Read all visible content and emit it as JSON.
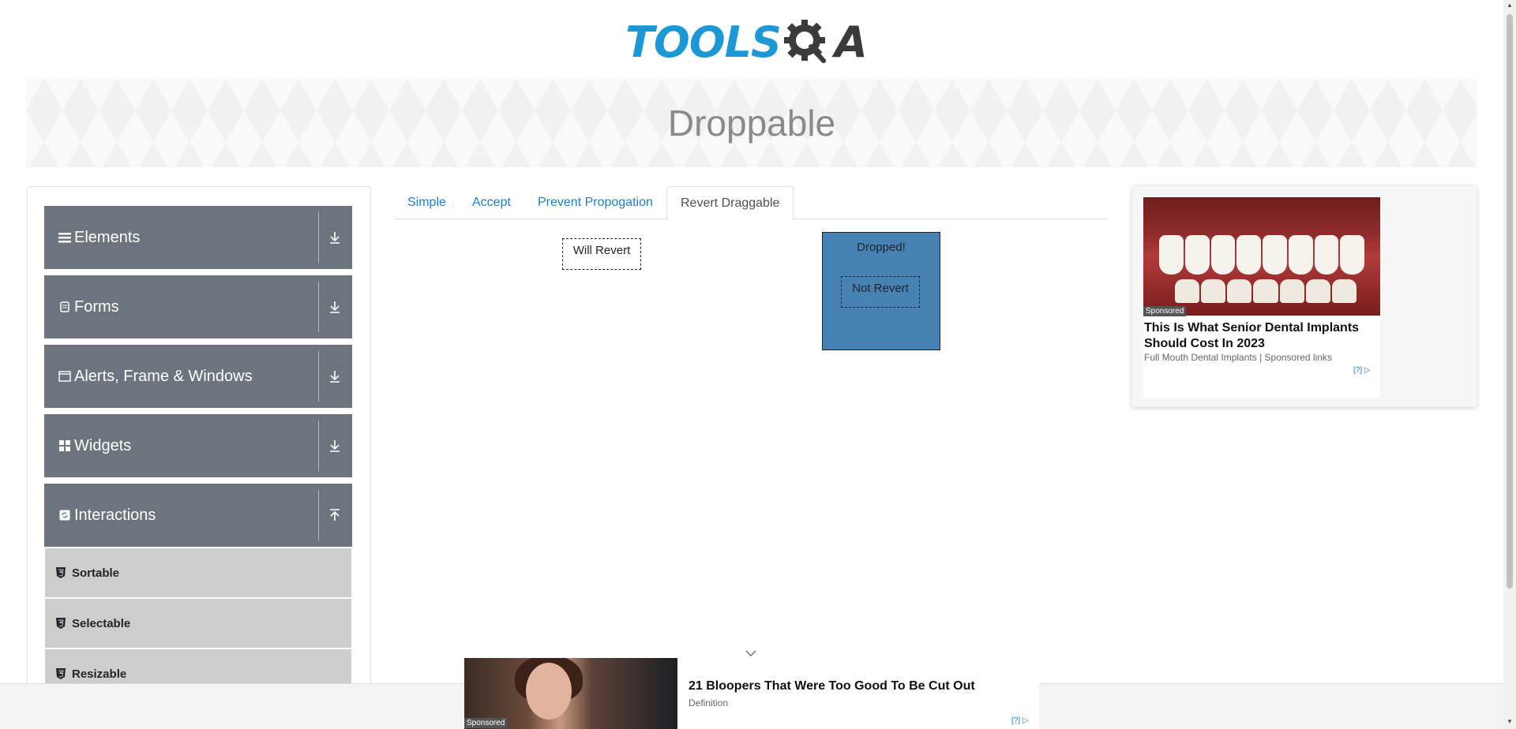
{
  "header": {
    "logo_main": "TOOLS",
    "logo_suffix": "A",
    "logo_alt": "ToolsQA"
  },
  "banner": {
    "title": "Droppable"
  },
  "sidebar": {
    "groups": [
      {
        "title": "Elements",
        "icon": "hamburger-icon"
      },
      {
        "title": "Forms",
        "icon": "form-icon"
      },
      {
        "title": "Alerts, Frame & Windows",
        "icon": "window-icon"
      },
      {
        "title": "Widgets",
        "icon": "widgets-icon"
      },
      {
        "title": "Interactions",
        "icon": "interactions-icon"
      }
    ],
    "items": [
      {
        "label": "Sortable"
      },
      {
        "label": "Selectable"
      },
      {
        "label": "Resizable"
      }
    ]
  },
  "tabs": [
    {
      "label": "Simple"
    },
    {
      "label": "Accept"
    },
    {
      "label": "Prevent Propogation"
    },
    {
      "label": "Revert Draggable"
    }
  ],
  "active_tab": "Revert Draggable",
  "drag": {
    "will_revert": "Will Revert",
    "drop_label": "Dropped!",
    "not_revert": "Not Revert"
  },
  "ad_right": {
    "badge": "Sponsored",
    "title": "This Is What Senior Dental Implants Should Cost In 2023",
    "subtitle": "Full Mouth Dental Implants | Sponsored links",
    "marks": "[?]"
  },
  "ad_bottom": {
    "badge": "Sponsored",
    "title": "21 Bloopers That Were Too Good To Be Cut Out",
    "subtitle": "Definition",
    "marks": "[?]"
  },
  "colors": {
    "accent": "#1b98d5",
    "sidebar_group": "#6c757d",
    "sidebar_item": "#cdcdcd",
    "drop_box": "#4682b4",
    "tab_link": "#1c7ed6"
  }
}
